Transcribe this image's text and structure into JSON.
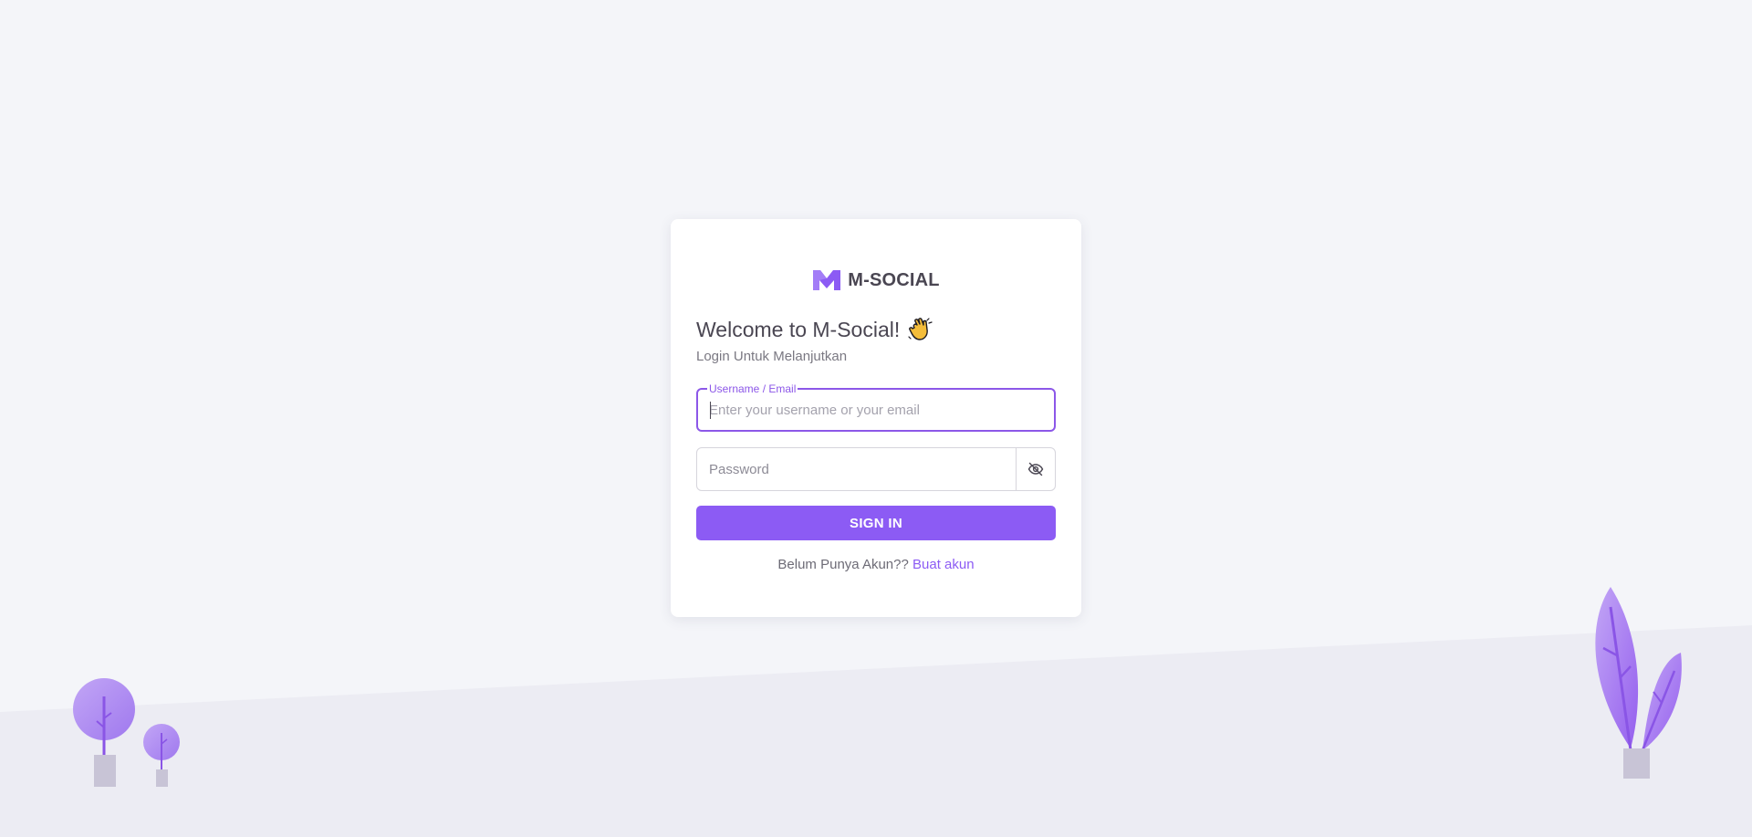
{
  "brand": {
    "name": "M-SOCIAL",
    "logo_icon": "m-logo-icon",
    "accent": "#8c5bf4"
  },
  "welcome": {
    "title": "Welcome to M-Social!",
    "emoji_icon": "waving-hand-icon",
    "subtitle": "Login Untuk Melanjutkan"
  },
  "form": {
    "username": {
      "label": "Username / Email",
      "placeholder": "Enter your username or your email",
      "value": ""
    },
    "password": {
      "placeholder": "Password",
      "value": "",
      "toggle_icon": "eye-off-icon"
    },
    "submit_label": "SIGN IN"
  },
  "signup": {
    "prompt": "Belum Punya Akun??",
    "link_label": "Buat akun"
  },
  "decorations": {
    "left": "tree-illustration",
    "right": "leaf-plant-illustration"
  }
}
